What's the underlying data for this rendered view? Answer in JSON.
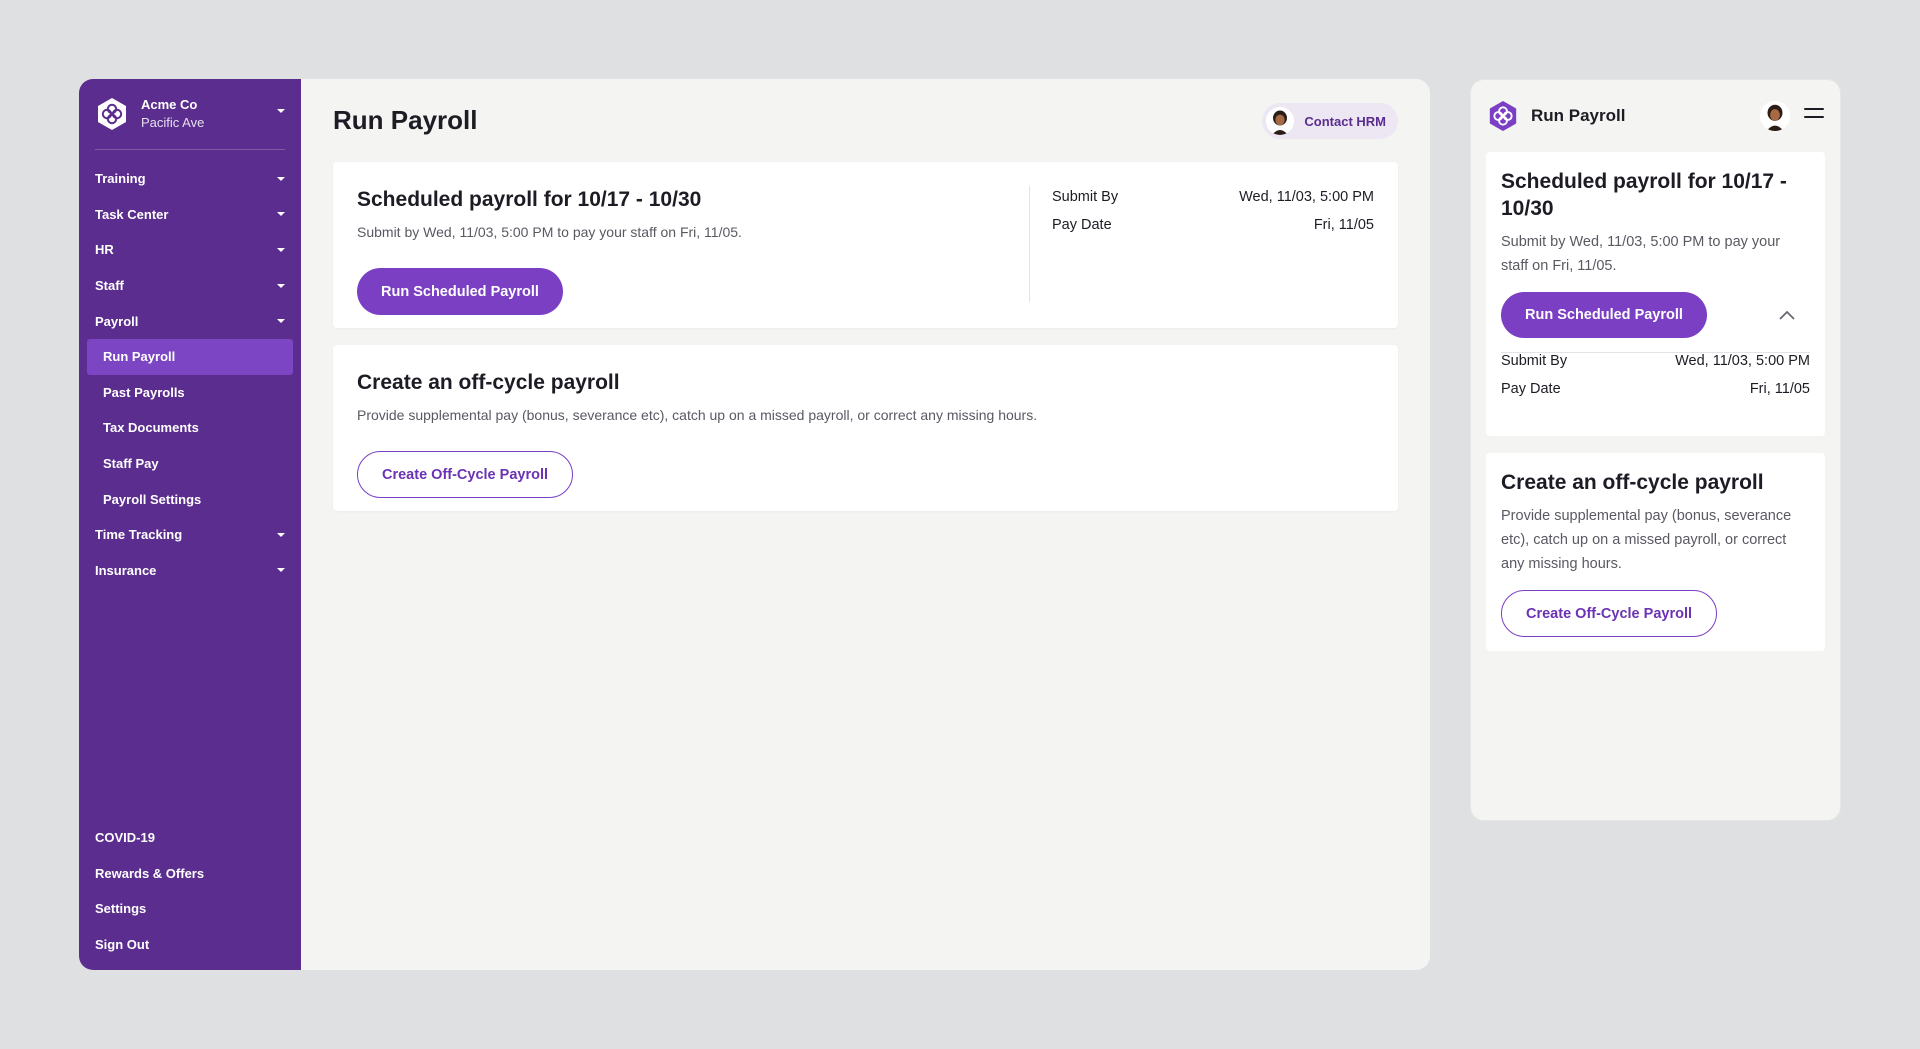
{
  "org": {
    "name": "Acme Co",
    "location": "Pacific Ave"
  },
  "nav": {
    "items": [
      {
        "label": "Training"
      },
      {
        "label": "Task Center"
      },
      {
        "label": "HR"
      },
      {
        "label": "Staff"
      },
      {
        "label": "Payroll"
      }
    ],
    "payroll_sub": [
      {
        "label": "Run Payroll",
        "active": true
      },
      {
        "label": "Past Payrolls"
      },
      {
        "label": "Tax Documents"
      },
      {
        "label": "Staff Pay"
      },
      {
        "label": "Payroll Settings"
      }
    ],
    "after": [
      {
        "label": "Time Tracking"
      },
      {
        "label": "Insurance"
      }
    ],
    "bottom": [
      {
        "label": "COVID-19"
      },
      {
        "label": "Rewards & Offers"
      },
      {
        "label": "Settings"
      },
      {
        "label": "Sign Out"
      }
    ]
  },
  "header": {
    "title": "Run Payroll",
    "contact_label": "Contact HRM"
  },
  "scheduled": {
    "title": "Scheduled payroll for 10/17 - 10/30",
    "description": "Submit by Wed, 11/03, 5:00 PM to pay your staff on Fri, 11/05.",
    "button_label": "Run Scheduled Payroll",
    "submit_by_label": "Submit By",
    "submit_by_value": "Wed, 11/03, 5:00 PM",
    "pay_date_label": "Pay Date",
    "pay_date_value": "Fri, 11/05"
  },
  "offcycle": {
    "title": "Create an off-cycle payroll",
    "description": "Provide supplemental pay (bonus, severance etc), catch up on a missed payroll, or correct any missing hours.",
    "button_label": "Create Off-Cycle Payroll"
  },
  "mobile": {
    "title": "Run Payroll"
  },
  "colors": {
    "brand_purple": "#5b2d8e",
    "accent_purple": "#7b3fc4",
    "background": "#dfe0e2"
  },
  "icons": {
    "logo": "hexagon-logo-icon",
    "caret": "caret-down-icon",
    "menu": "hamburger-menu-icon",
    "collapse": "chevron-up-icon"
  }
}
